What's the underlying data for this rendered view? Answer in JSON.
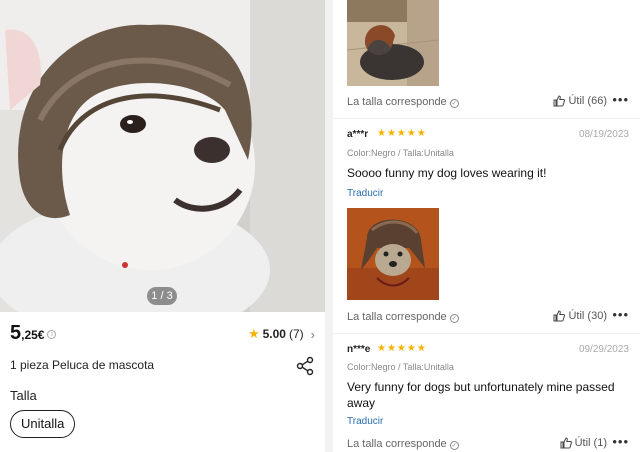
{
  "product": {
    "image_counter": "1 / 3",
    "price_integer": "5",
    "price_decimal": ",25€",
    "rating_score": "5.00",
    "rating_count": "(7)",
    "title": "1 pieza Peluca de mascota",
    "size_label": "Talla",
    "size_option": "Unitalla"
  },
  "reviews": {
    "fit_text": "La talla corresponde",
    "items": [
      {
        "helpful": "Útil (66)"
      },
      {
        "reviewer": "a***r",
        "stars": "★★★★★",
        "date": "08/19/2023",
        "variant": "Color:Negro / Talla:Unitalla",
        "text": "Soooo funny my dog loves wearing it!",
        "translate": "Traducir",
        "helpful": "Útil (30)"
      },
      {
        "reviewer": "n***e",
        "stars": "★★★★★",
        "date": "09/29/2023",
        "variant": "Color:Negro / Talla:Unitalla",
        "text": "Very funny for dogs but unfortunately mine passed away",
        "translate": "Traducir",
        "helpful": "Útil (1)"
      }
    ],
    "more_label": "•••"
  },
  "colors": {
    "star": "#f5b301",
    "link": "#2b6cb0"
  }
}
